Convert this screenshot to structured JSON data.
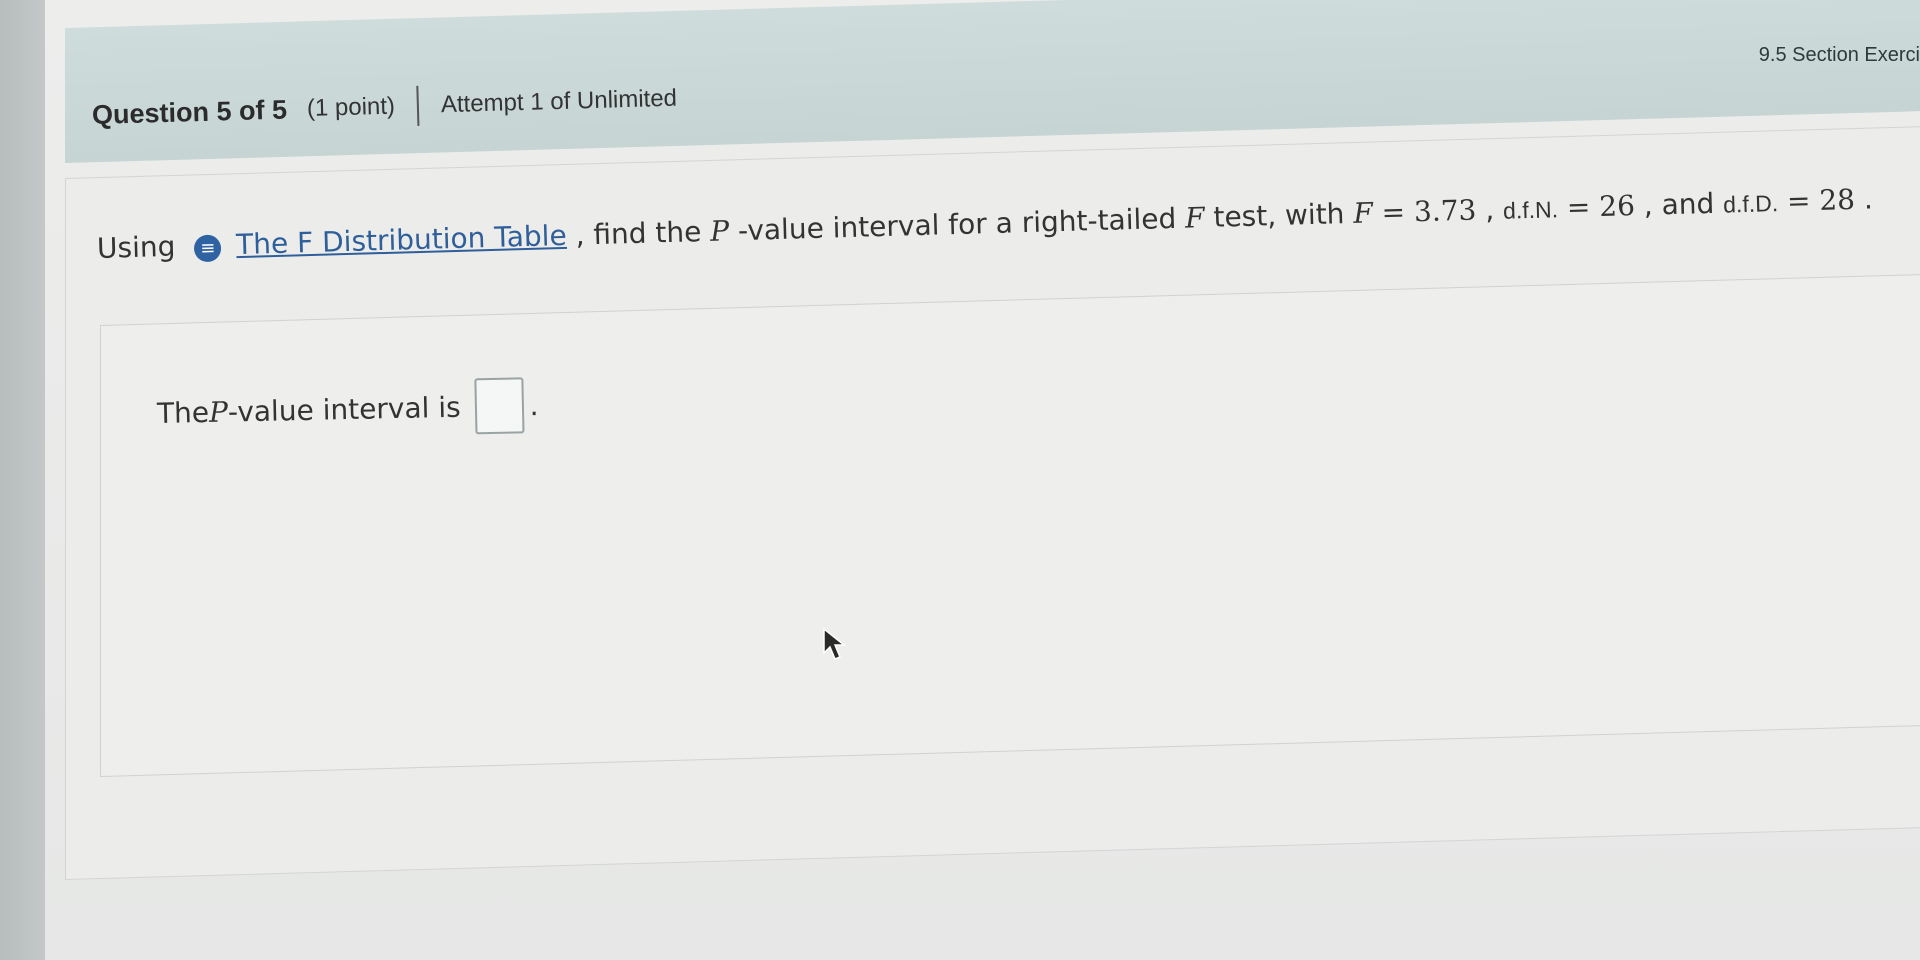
{
  "header": {
    "section_title": "9.5 Section Exercis",
    "question_number": "Question 5 of 5",
    "points": "(1 point)",
    "attempt": "Attempt 1 of Unlimited"
  },
  "question": {
    "prefix": "Using",
    "info_icon": "info-icon",
    "link_text": "The F Distribution Table",
    "text_mid": ", find the ",
    "p_symbol": "P",
    "text_after_p": "-value interval for a right-tailed ",
    "f_symbol": "F",
    "text_test_with": " test, with ",
    "f_value_symbol": "F",
    "f_equals": "=",
    "f_value": "3.73",
    "comma1": ", ",
    "dfn_label": "d.f.N.",
    "dfn_equals": "=",
    "dfn_value": "26",
    "comma_and": ", and ",
    "dfd_label": "d.f.D.",
    "dfd_equals": "=",
    "dfd_value": "28",
    "end_period": "."
  },
  "answer": {
    "prefix": "The ",
    "p_symbol": "P",
    "suffix": "-value interval is",
    "input_value": "",
    "end_period": "."
  }
}
